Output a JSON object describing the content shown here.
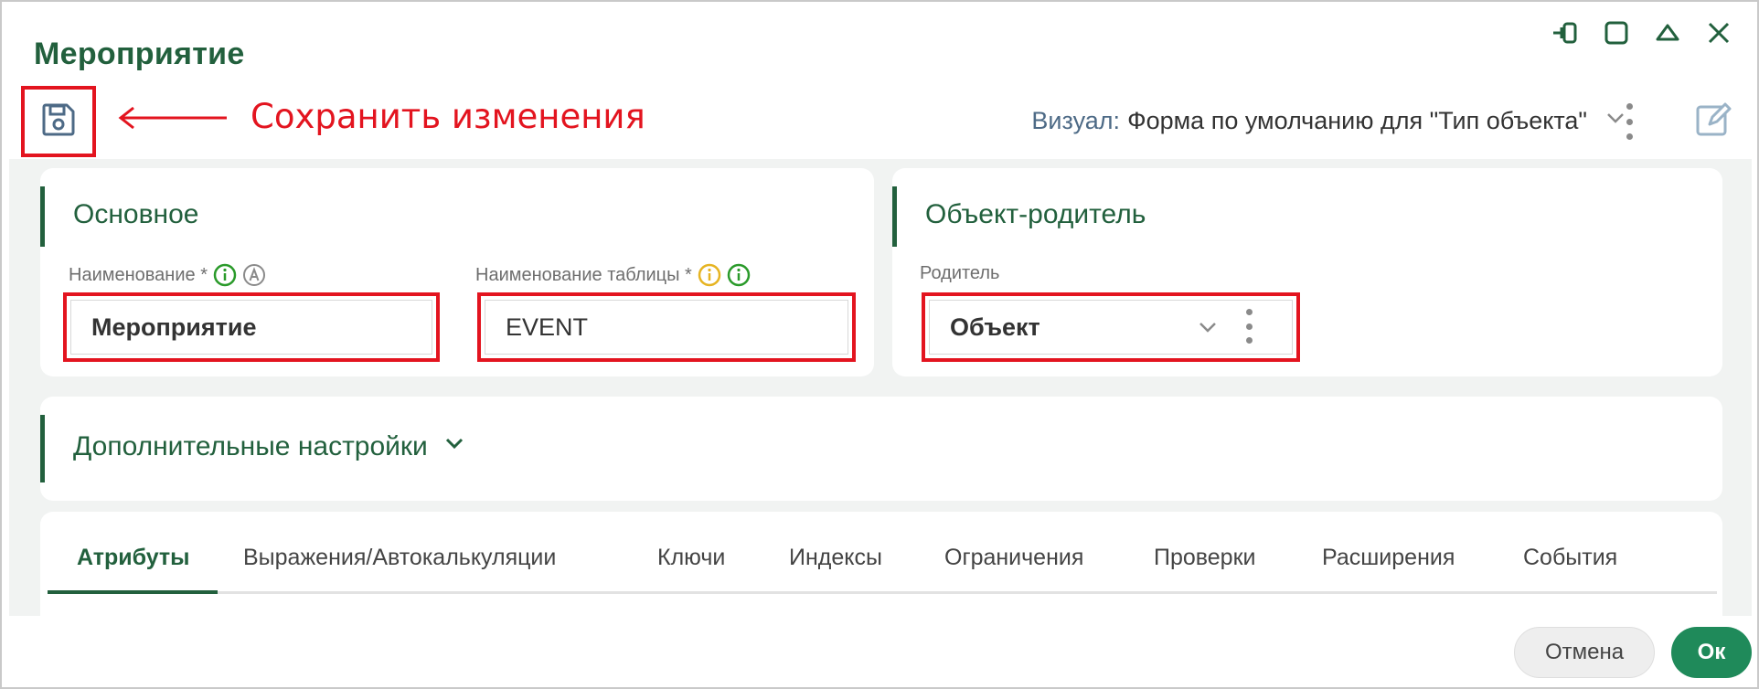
{
  "window": {
    "title": "Мероприятие"
  },
  "annotation": {
    "text": "Сохранить изменения",
    "color": "#e3141f"
  },
  "toolbar": {
    "visual_label": "Визуал:",
    "visual_value": "Форма по умолчанию для \"Тип объекта\""
  },
  "main_section": {
    "title": "Основное",
    "name_label": "Наименование *",
    "name_value": "Мероприятие",
    "table_label": "Наименование таблицы *",
    "table_value": "EVENT"
  },
  "parent_section": {
    "title": "Объект-родитель",
    "parent_label": "Родитель",
    "parent_value": "Объект"
  },
  "advanced": {
    "title": "Дополнительные настройки"
  },
  "tabs": [
    {
      "label": "Атрибуты",
      "active": true
    },
    {
      "label": "Выражения/Автокалькуляции",
      "active": false
    },
    {
      "label": "Ключи",
      "active": false
    },
    {
      "label": "Индексы",
      "active": false
    },
    {
      "label": "Ограничения",
      "active": false
    },
    {
      "label": "Проверки",
      "active": false
    },
    {
      "label": "Расширения",
      "active": false
    },
    {
      "label": "События",
      "active": false
    }
  ],
  "footer": {
    "cancel_label": "Отмена",
    "ok_label": "Ок"
  },
  "colors": {
    "accent": "#22603d",
    "highlight": "#e3141f",
    "link": "#2f6fb0",
    "ok_button": "#1f8a5a"
  },
  "icons": {
    "save": "save-icon",
    "pin": "pin-icon",
    "maximize": "maximize-icon",
    "collapse": "collapse-icon",
    "close": "close-icon",
    "edit": "edit-icon",
    "info": "info-icon"
  }
}
